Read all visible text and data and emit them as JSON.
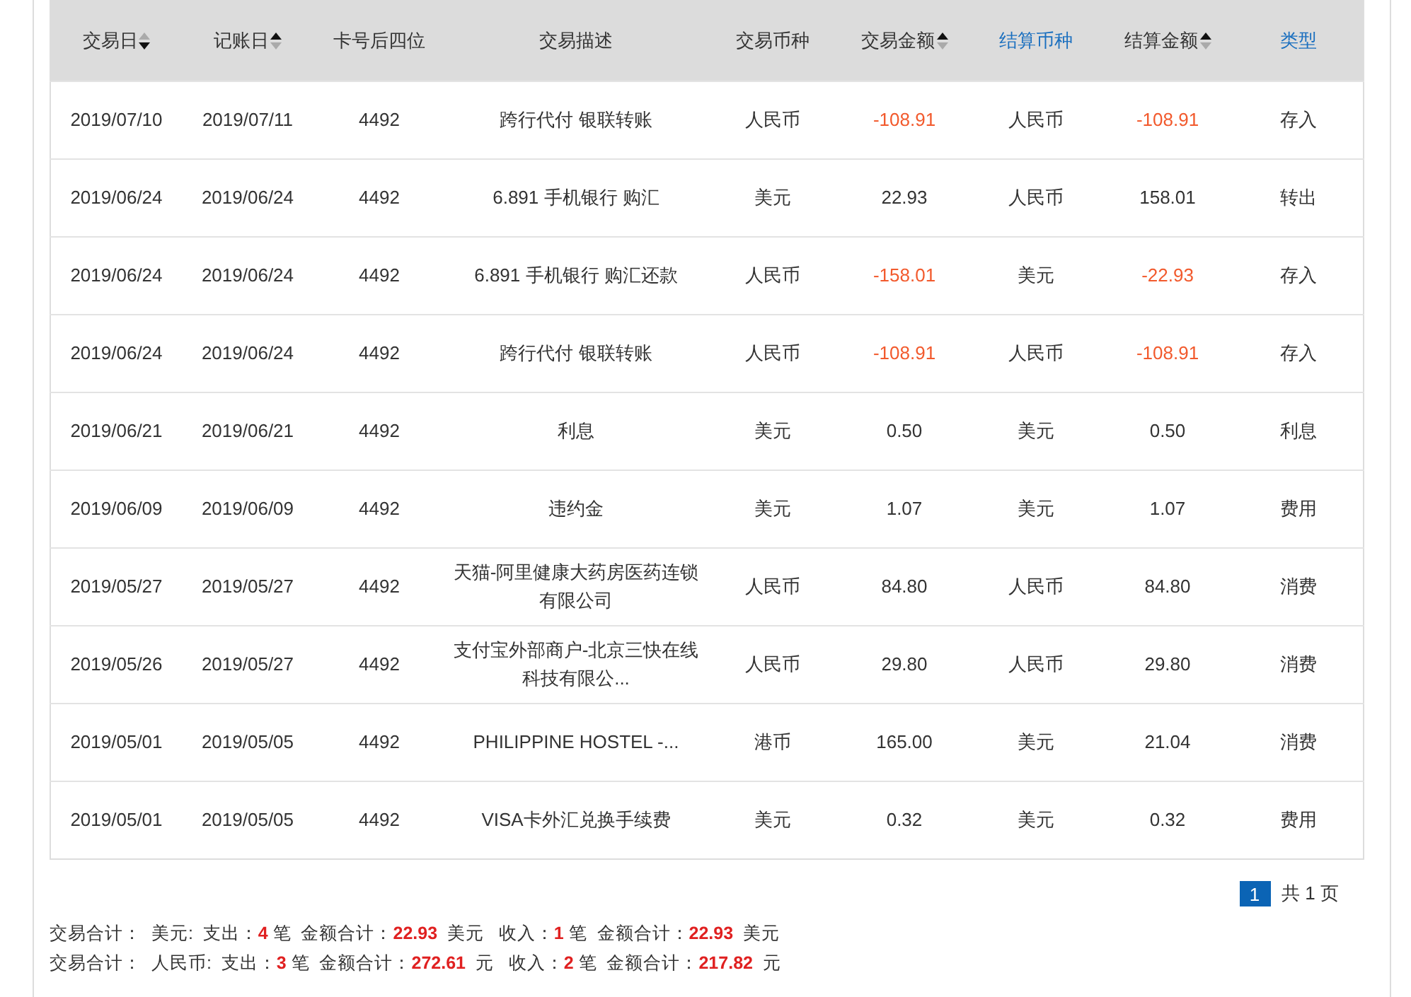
{
  "table": {
    "columns": [
      {
        "label": "交易日",
        "sort_ascending": false,
        "link": false
      },
      {
        "label": "记账日",
        "sort_ascending": true,
        "link": false
      },
      {
        "label": "卡号后四位",
        "link": false
      },
      {
        "label": "交易描述",
        "link": false
      },
      {
        "label": "交易币种",
        "link": false
      },
      {
        "label": "交易金额",
        "sort_ascending": true,
        "link": false
      },
      {
        "label": "结算币种",
        "link": true
      },
      {
        "label": "结算金额",
        "sort_ascending": true,
        "link": false
      },
      {
        "label": "类型",
        "link": true
      }
    ],
    "rows": [
      {
        "cells": [
          "2019/07/10",
          "2019/07/11",
          "4492",
          "跨行代付 银联转账",
          "人民币",
          "-108.91",
          "人民币",
          "-108.91",
          "存入"
        ],
        "trade_amount_negative": true,
        "settle_amount_negative": true
      },
      {
        "cells": [
          "2019/06/24",
          "2019/06/24",
          "4492",
          "6.891 手机银行 购汇",
          "美元",
          "22.93",
          "人民币",
          "158.01",
          "转出"
        ],
        "trade_amount_negative": false,
        "settle_amount_negative": false
      },
      {
        "cells": [
          "2019/06/24",
          "2019/06/24",
          "4492",
          "6.891 手机银行 购汇还款",
          "人民币",
          "-158.01",
          "美元",
          "-22.93",
          "存入"
        ],
        "trade_amount_negative": true,
        "settle_amount_negative": true
      },
      {
        "cells": [
          "2019/06/24",
          "2019/06/24",
          "4492",
          "跨行代付 银联转账",
          "人民币",
          "-108.91",
          "人民币",
          "-108.91",
          "存入"
        ],
        "trade_amount_negative": true,
        "settle_amount_negative": true
      },
      {
        "cells": [
          "2019/06/21",
          "2019/06/21",
          "4492",
          "利息",
          "美元",
          "0.50",
          "美元",
          "0.50",
          "利息"
        ],
        "trade_amount_negative": false,
        "settle_amount_negative": false
      },
      {
        "cells": [
          "2019/06/09",
          "2019/06/09",
          "4492",
          "违约金",
          "美元",
          "1.07",
          "美元",
          "1.07",
          "费用"
        ],
        "trade_amount_negative": false,
        "settle_amount_negative": false
      },
      {
        "cells": [
          "2019/05/27",
          "2019/05/27",
          "4492",
          "天猫-阿里健康大药房医药连锁有限公司",
          "人民币",
          "84.80",
          "人民币",
          "84.80",
          "消费"
        ],
        "trade_amount_negative": false,
        "settle_amount_negative": false
      },
      {
        "cells": [
          "2019/05/26",
          "2019/05/27",
          "4492",
          "支付宝外部商户-北京三快在线科技有限公...",
          "人民币",
          "29.80",
          "人民币",
          "29.80",
          "消费"
        ],
        "trade_amount_negative": false,
        "settle_amount_negative": false
      },
      {
        "cells": [
          "2019/05/01",
          "2019/05/05",
          "4492",
          "PHILIPPINE HOSTEL -...",
          "港币",
          "165.00",
          "美元",
          "21.04",
          "消费"
        ],
        "trade_amount_negative": false,
        "settle_amount_negative": false
      },
      {
        "cells": [
          "2019/05/01",
          "2019/05/05",
          "4492",
          "VISA卡外汇兑换手续费",
          "美元",
          "0.32",
          "美元",
          "0.32",
          "费用"
        ],
        "trade_amount_negative": false,
        "settle_amount_negative": false
      }
    ]
  },
  "pagination": {
    "pages": [
      {
        "label": "1",
        "selected": true
      }
    ],
    "total": "共 1 页"
  },
  "summary": [
    "交易合计：  美元:  支出：**4** 笔  金额合计：**22.93**  美元   收入：**1** 笔  金额合计：**22.93**  美元",
    "交易合计：  人民币:  支出：**3** 笔  金额合计：**272.61**  元   收入：**2** 笔  金额合计：**217.82**  元"
  ]
}
